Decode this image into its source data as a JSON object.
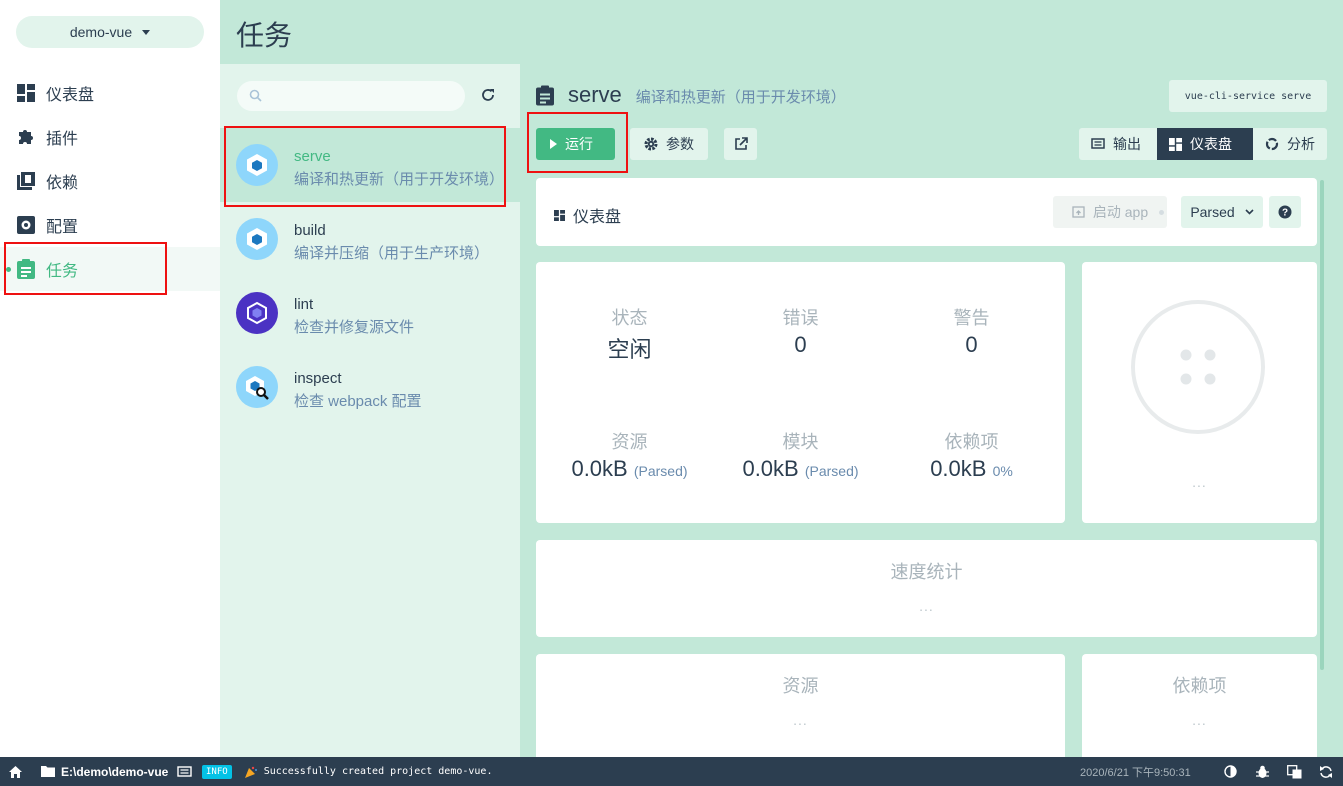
{
  "project": {
    "name": "demo-vue"
  },
  "nav": {
    "items": [
      {
        "label": "仪表盘",
        "icon": "dashboard-icon"
      },
      {
        "label": "插件",
        "icon": "puzzle-icon"
      },
      {
        "label": "依赖",
        "icon": "library-icon"
      },
      {
        "label": "配置",
        "icon": "settings-icon"
      },
      {
        "label": "任务",
        "icon": "clipboard-icon"
      }
    ],
    "active": "任务"
  },
  "header": {
    "title": "任务"
  },
  "tasks": {
    "search_placeholder": "",
    "items": [
      {
        "name": "serve",
        "desc": "编译和热更新（用于开发环境）",
        "icon": "webpack-icon",
        "selected": true
      },
      {
        "name": "build",
        "desc": "编译并压缩（用于生产环境）",
        "icon": "webpack-icon"
      },
      {
        "name": "lint",
        "desc": "检查并修复源文件",
        "icon": "eslint-icon"
      },
      {
        "name": "inspect",
        "desc": "检查 webpack 配置",
        "icon": "webpack-inspect-icon"
      }
    ]
  },
  "detail": {
    "name": "serve",
    "desc": "编译和热更新（用于开发环境）",
    "command": "vue-cli-service serve",
    "run_label": "运行",
    "params_label": "参数",
    "views": {
      "output": "输出",
      "dashboard": "仪表盘",
      "analyze": "分析"
    },
    "active_view": "仪表盘"
  },
  "dashboard": {
    "title": "仪表盘",
    "launch_label": "启动 app",
    "mode": "Parsed",
    "stats": {
      "status_label": "状态",
      "status_value": "空闲",
      "errors_label": "错误",
      "errors_value": "0",
      "warnings_label": "警告",
      "warnings_value": "0",
      "assets_label": "资源",
      "assets_value": "0.0kB",
      "assets_suffix": "(Parsed)",
      "modules_label": "模块",
      "modules_value": "0.0kB",
      "modules_suffix": "(Parsed)",
      "deps_label": "依赖项",
      "deps_value": "0.0kB",
      "deps_suffix": "0%"
    },
    "donut_ellipsis": "...",
    "speed_title": "速度统计",
    "speed_ellipsis": "...",
    "assets_title": "资源",
    "assets_ellipsis": "...",
    "deps_title": "依赖项",
    "deps_ellipsis": "..."
  },
  "statusbar": {
    "path": "E:\\demo\\demo-vue",
    "log_level": "INFO",
    "message": "Successfully created project demo-vue.",
    "time": "2020/6/21 下午9:50:31"
  },
  "colors": {
    "accent": "#42b983",
    "dark": "#2c3e50",
    "light_green": "#c2e8d8",
    "highlight": "#ee1111"
  }
}
